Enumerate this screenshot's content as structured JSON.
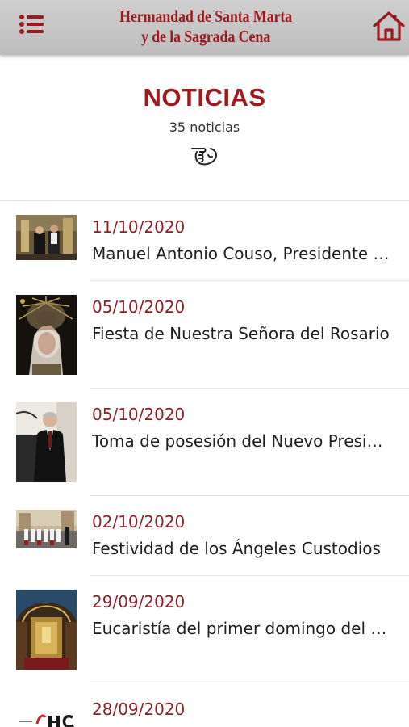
{
  "header": {
    "brand_line1": "Hermandad de Santa Marta",
    "brand_line2": "y de la Sagrada Cena",
    "menu_icon": "hamburger-menu-icon",
    "home_icon": "home-icon"
  },
  "page": {
    "title": "NOTICIAS",
    "count": "35 noticias",
    "hint_icon": "pointing-hand-icon"
  },
  "colors": {
    "accent": "#9b1b1f",
    "date": "#8e1f23",
    "topbar": "#c6c6c6"
  },
  "news": [
    {
      "date": "11/10/2020",
      "title": "Manuel Antonio Couso, Presidente del Consejo"
    },
    {
      "date": "05/10/2020",
      "title": "Fiesta de Nuestra Señora del Rosario"
    },
    {
      "date": "05/10/2020",
      "title": "Toma de posesión del Nuevo Presidente"
    },
    {
      "date": "02/10/2020",
      "title": "Festividad de los Ángeles Custodios"
    },
    {
      "date": "29/09/2020",
      "title": "Eucaristía del primer domingo del mes"
    },
    {
      "date": "28/09/2020",
      "title": ""
    }
  ]
}
